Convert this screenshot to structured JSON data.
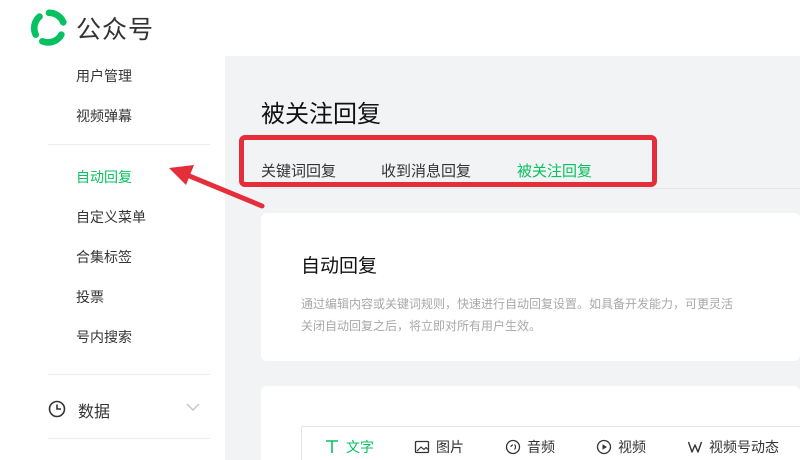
{
  "header": {
    "brand": "公众号"
  },
  "sidebar": {
    "items": [
      {
        "label": "用户管理"
      },
      {
        "label": "视频弹幕"
      },
      {
        "label": "自动回复"
      },
      {
        "label": "自定义菜单"
      },
      {
        "label": "合集标签"
      },
      {
        "label": "投票"
      },
      {
        "label": "号内搜索"
      }
    ],
    "active_index": 2,
    "group": {
      "label": "数据"
    }
  },
  "main": {
    "title": "被关注回复",
    "tabs": [
      {
        "label": "关键词回复"
      },
      {
        "label": "收到消息回复"
      },
      {
        "label": "被关注回复"
      }
    ],
    "active_tab": 2,
    "card": {
      "title": "自动回复",
      "desc_line1": "通过编辑内容或关键词规则，快速进行自动回复设置。如具备开发能力，可更灵活",
      "desc_line2": "关闭自动回复之后，将立即对所有用户生效。"
    },
    "editor_tabs": [
      {
        "label": "文字",
        "icon": "text-icon"
      },
      {
        "label": "图片",
        "icon": "image-icon"
      },
      {
        "label": "音频",
        "icon": "audio-icon"
      },
      {
        "label": "视频",
        "icon": "video-icon"
      },
      {
        "label": "视频号动态",
        "icon": "channels-icon"
      }
    ],
    "editor_active": 0
  },
  "colors": {
    "accent": "#07c160",
    "annotation_red": "#e42f3a",
    "page_bg": "#f2f3f5"
  }
}
